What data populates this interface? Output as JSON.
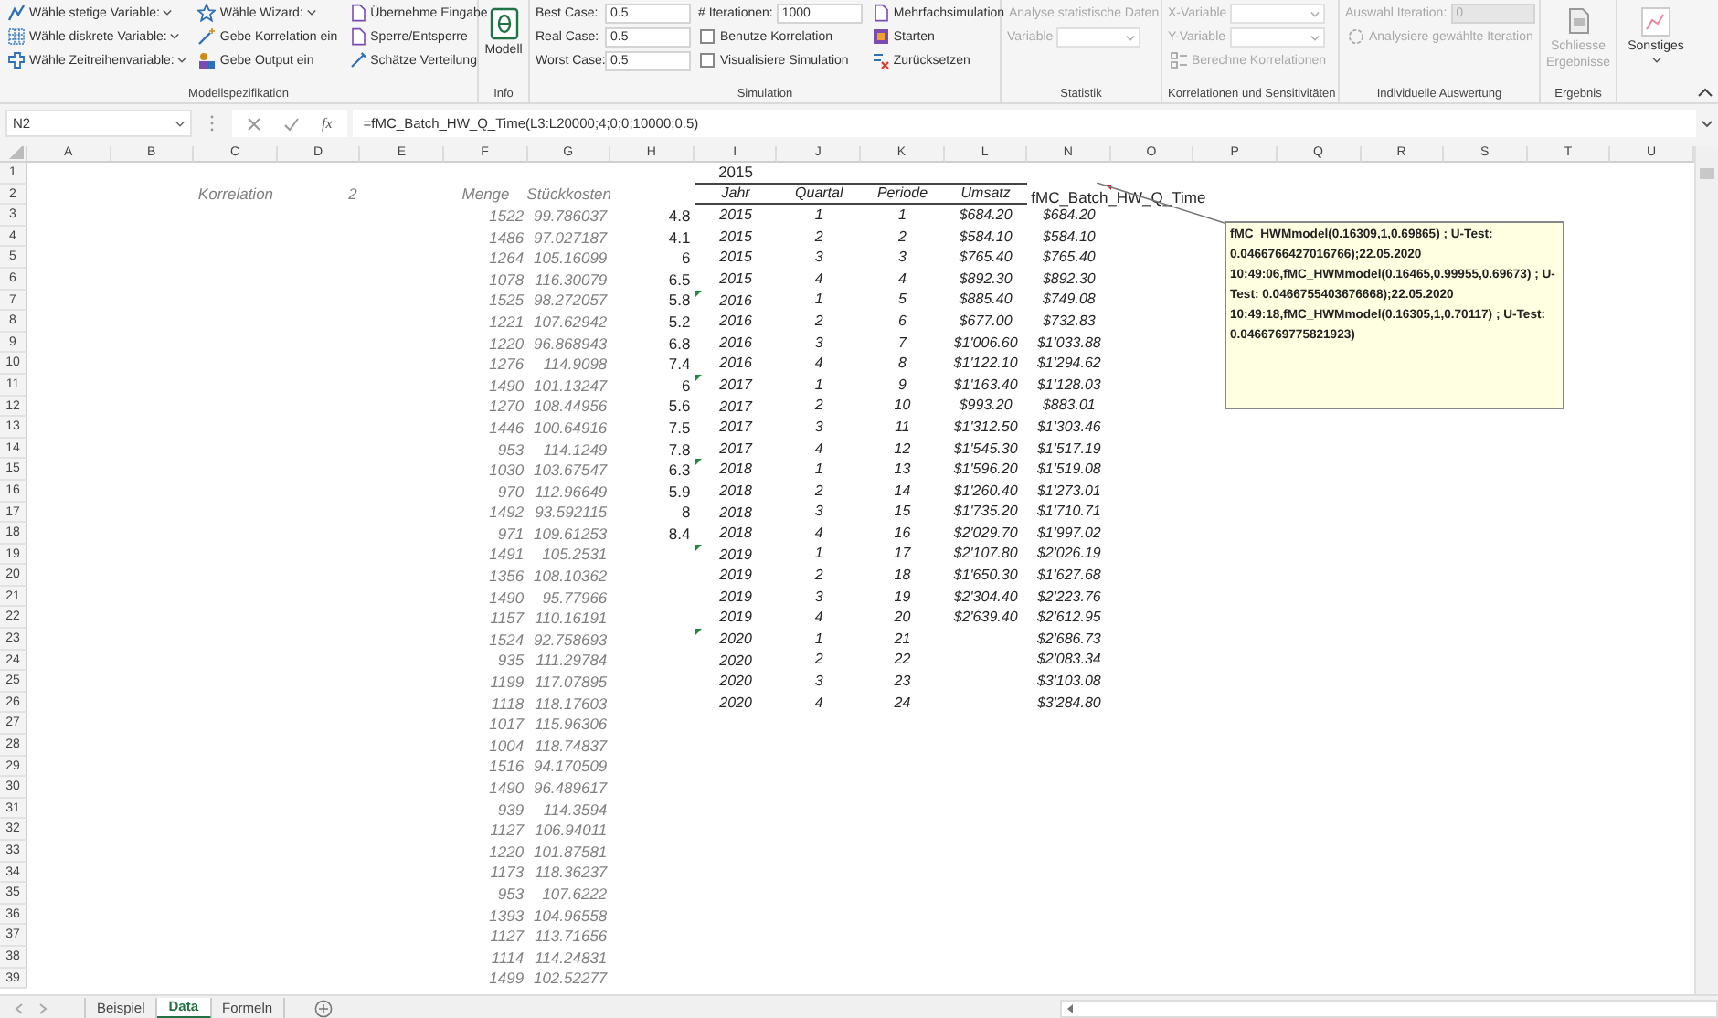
{
  "ribbon": {
    "modellspezifikation": {
      "label": "Modellspezifikation",
      "columns": [
        [
          {
            "label": "Wähle stetige Variable:",
            "dropdown": true
          },
          {
            "label": "Wähle diskrete Variable:",
            "dropdown": true
          },
          {
            "label": "Wähle Zeitreihenvariable:",
            "dropdown": true
          }
        ],
        [
          {
            "label": "Wähle Wizard:",
            "dropdown": true
          },
          {
            "label": "Gebe Korrelation ein",
            "dropdown": false
          },
          {
            "label": "Gebe Output ein",
            "dropdown": false
          }
        ],
        [
          {
            "label": "Übernehme Eingabe",
            "dropdown": false
          },
          {
            "label": "Sperre/Entsperre",
            "dropdown": false
          },
          {
            "label": "Schätze Verteilung",
            "dropdown": false
          }
        ]
      ]
    },
    "info": {
      "label": "Info",
      "button": "Modell"
    },
    "simulation": {
      "label": "Simulation",
      "fields": [
        {
          "label": "Best Case:",
          "value": "0.5"
        },
        {
          "label": "Real Case:",
          "value": "0.5"
        },
        {
          "label": "Worst Case:",
          "value": "0.5"
        }
      ],
      "iterations": {
        "label": "# Iterationen:",
        "value": "1000"
      },
      "checkboxes": [
        {
          "label": "Benutze Korrelation",
          "checked": false
        },
        {
          "label": "Visualisiere Simulation",
          "checked": false
        }
      ],
      "buttons": [
        "Mehrfachsimulation",
        "Starten",
        "Zurücksetzen"
      ]
    },
    "statistik": {
      "label": "Statistik",
      "button": {
        "label": "Analyse statistische Daten",
        "disabled": true
      },
      "dropdown": {
        "label": "Variable",
        "disabled": true
      }
    },
    "korrelationen": {
      "label": "Korrelationen und Sensitivitäten",
      "dropdowns": [
        {
          "label": "X-Variable",
          "disabled": true
        },
        {
          "label": "Y-Variable",
          "disabled": true
        }
      ],
      "button": {
        "label": "Berechne Korrelationen",
        "disabled": true
      }
    },
    "auswertung": {
      "label": "Individuelle Auswertung",
      "field": {
        "label": "Auswahl Iteration:",
        "value": "0",
        "disabled": true
      },
      "button": {
        "label": "Analysiere gewählte Iteration",
        "disabled": true
      }
    },
    "ergebnis": {
      "label": "Ergebnis",
      "button": {
        "label": "Schliesse Ergebnisse",
        "disabled": true
      }
    },
    "sonstiges": {
      "button": "Sonstiges"
    }
  },
  "formula_bar": {
    "name_box": "N2",
    "function_label": "fx",
    "formula": "=fMC_Batch_HW_Q_Time(L3:L20000;4;0;0;10000;0.5)"
  },
  "sheet": {
    "columns": [
      "A",
      "B",
      "C",
      "D",
      "E",
      "F",
      "G",
      "H",
      "I",
      "J",
      "K",
      "L",
      "N",
      "O",
      "P",
      "Q",
      "R",
      "S",
      "T",
      "U"
    ],
    "row_numbers": [
      "1",
      "2",
      "3",
      "4",
      "5",
      "6",
      "7",
      "8",
      "9",
      "10",
      "11",
      "12",
      "13",
      "14",
      "15",
      "16",
      "17",
      "18",
      "19",
      "20",
      "21",
      "22",
      "23",
      "24",
      "25",
      "26",
      "27",
      "28",
      "29",
      "30",
      "31",
      "32",
      "33",
      "34",
      "35",
      "36",
      "37",
      "38",
      "39"
    ],
    "korrelation": {
      "label": "Korrelation",
      "value": "2"
    },
    "data_table": {
      "headers": [
        "Menge",
        "Stückkosten"
      ],
      "rows": [
        {
          "menge": "1522",
          "stueckkosten": "99.786037"
        },
        {
          "menge": "1486",
          "stueckkosten": "97.027187"
        },
        {
          "menge": "1264",
          "stueckkosten": "105.16099"
        },
        {
          "menge": "1078",
          "stueckkosten": "116.30079"
        },
        {
          "menge": "1525",
          "stueckkosten": "98.272057"
        },
        {
          "menge": "1221",
          "stueckkosten": "107.62942"
        },
        {
          "menge": "1220",
          "stueckkosten": "96.868943"
        },
        {
          "menge": "1276",
          "stueckkosten": "114.9098"
        },
        {
          "menge": "1490",
          "stueckkosten": "101.13247"
        },
        {
          "menge": "1270",
          "stueckkosten": "108.44956"
        },
        {
          "menge": "1446",
          "stueckkosten": "100.64916"
        },
        {
          "menge": "953",
          "stueckkosten": "114.1249"
        },
        {
          "menge": "1030",
          "stueckkosten": "103.67547"
        },
        {
          "menge": "970",
          "stueckkosten": "112.96649"
        },
        {
          "menge": "1492",
          "stueckkosten": "93.592115"
        },
        {
          "menge": "971",
          "stueckkosten": "109.61253"
        },
        {
          "menge": "1491",
          "stueckkosten": "105.2531"
        },
        {
          "menge": "1356",
          "stueckkosten": "108.10362"
        },
        {
          "menge": "1490",
          "stueckkosten": "95.77966"
        },
        {
          "menge": "1157",
          "stueckkosten": "110.16191"
        },
        {
          "menge": "1524",
          "stueckkosten": "92.758693"
        },
        {
          "menge": "935",
          "stueckkosten": "111.29784"
        },
        {
          "menge": "1199",
          "stueckkosten": "117.07895"
        },
        {
          "menge": "1118",
          "stueckkosten": "118.17603"
        },
        {
          "menge": "1017",
          "stueckkosten": "115.96306"
        },
        {
          "menge": "1004",
          "stueckkosten": "118.74837"
        },
        {
          "menge": "1516",
          "stueckkosten": "94.170509"
        },
        {
          "menge": "1490",
          "stueckkosten": "96.489617"
        },
        {
          "menge": "939",
          "stueckkosten": "114.3594"
        },
        {
          "menge": "1127",
          "stueckkosten": "106.94011"
        },
        {
          "menge": "1220",
          "stueckkosten": "101.87581"
        },
        {
          "menge": "1173",
          "stueckkosten": "118.36237"
        },
        {
          "menge": "953",
          "stueckkosten": "107.6222"
        },
        {
          "menge": "1393",
          "stueckkosten": "104.96558"
        },
        {
          "menge": "1127",
          "stueckkosten": "113.71656"
        },
        {
          "menge": "1114",
          "stueckkosten": "114.24831"
        },
        {
          "menge": "1499",
          "stueckkosten": "102.52277"
        }
      ]
    },
    "main_table": {
      "title": "2015",
      "headers": [
        "Jahr",
        "Quartal",
        "Periode",
        "Umsatz",
        "fMC_Batch_HW_Q_Time"
      ],
      "rows": [
        {
          "column_h": "4.8",
          "jahr": "2015",
          "quartal": "1",
          "periode": "1",
          "umsatz": "$684.20",
          "forecast": "$684.20",
          "warning": false
        },
        {
          "column_h": "4.1",
          "jahr": "2015",
          "quartal": "2",
          "periode": "2",
          "umsatz": "$584.10",
          "forecast": "$584.10",
          "warning": false
        },
        {
          "column_h": "6",
          "jahr": "2015",
          "quartal": "3",
          "periode": "3",
          "umsatz": "$765.40",
          "forecast": "$765.40",
          "warning": false
        },
        {
          "column_h": "6.5",
          "jahr": "2015",
          "quartal": "4",
          "periode": "4",
          "umsatz": "$892.30",
          "forecast": "$892.30",
          "warning": false
        },
        {
          "column_h": "5.8",
          "jahr": "2016",
          "quartal": "1",
          "periode": "5",
          "umsatz": "$885.40",
          "forecast": "$749.08",
          "warning": true
        },
        {
          "column_h": "5.2",
          "jahr": "2016",
          "quartal": "2",
          "periode": "6",
          "umsatz": "$677.00",
          "forecast": "$732.83",
          "warning": false
        },
        {
          "column_h": "6.8",
          "jahr": "2016",
          "quartal": "3",
          "periode": "7",
          "umsatz": "$1'006.60",
          "forecast": "$1'033.88",
          "warning": false
        },
        {
          "column_h": "7.4",
          "jahr": "2016",
          "quartal": "4",
          "periode": "8",
          "umsatz": "$1'122.10",
          "forecast": "$1'294.62",
          "warning": false
        },
        {
          "column_h": "6",
          "jahr": "2017",
          "quartal": "1",
          "periode": "9",
          "umsatz": "$1'163.40",
          "forecast": "$1'128.03",
          "warning": true
        },
        {
          "column_h": "5.6",
          "jahr": "2017",
          "quartal": "2",
          "periode": "10",
          "umsatz": "$993.20",
          "forecast": "$883.01",
          "warning": false
        },
        {
          "column_h": "7.5",
          "jahr": "2017",
          "quartal": "3",
          "periode": "11",
          "umsatz": "$1'312.50",
          "forecast": "$1'303.46",
          "warning": false
        },
        {
          "column_h": "7.8",
          "jahr": "2017",
          "quartal": "4",
          "periode": "12",
          "umsatz": "$1'545.30",
          "forecast": "$1'517.19",
          "warning": false
        },
        {
          "column_h": "6.3",
          "jahr": "2018",
          "quartal": "1",
          "periode": "13",
          "umsatz": "$1'596.20",
          "forecast": "$1'519.08",
          "warning": true
        },
        {
          "column_h": "5.9",
          "jahr": "2018",
          "quartal": "2",
          "periode": "14",
          "umsatz": "$1'260.40",
          "forecast": "$1'273.01",
          "warning": false
        },
        {
          "column_h": "8",
          "jahr": "2018",
          "quartal": "3",
          "periode": "15",
          "umsatz": "$1'735.20",
          "forecast": "$1'710.71",
          "warning": false
        },
        {
          "column_h": "8.4",
          "jahr": "2018",
          "quartal": "4",
          "periode": "16",
          "umsatz": "$2'029.70",
          "forecast": "$1'997.02",
          "warning": false
        },
        {
          "jahr": "2019",
          "quartal": "1",
          "periode": "17",
          "umsatz": "$2'107.80",
          "forecast": "$2'026.19",
          "warning": true
        },
        {
          "jahr": "2019",
          "quartal": "2",
          "periode": "18",
          "umsatz": "$1'650.30",
          "forecast": "$1'627.68",
          "warning": false
        },
        {
          "jahr": "2019",
          "quartal": "3",
          "periode": "19",
          "umsatz": "$2'304.40",
          "forecast": "$2'223.76",
          "warning": false
        },
        {
          "jahr": "2019",
          "quartal": "4",
          "periode": "20",
          "umsatz": "$2'639.40",
          "forecast": "$2'612.95",
          "warning": false
        },
        {
          "jahr": "2020",
          "quartal": "1",
          "periode": "21",
          "forecast": "$2'686.73",
          "warning": true
        },
        {
          "jahr": "2020",
          "quartal": "2",
          "periode": "22",
          "forecast": "$2'083.34",
          "warning": false
        },
        {
          "jahr": "2020",
          "quartal": "3",
          "periode": "23",
          "forecast": "$3'103.08",
          "warning": false
        },
        {
          "jahr": "2020",
          "quartal": "4",
          "periode": "24",
          "forecast": "$3'284.80",
          "warning": false
        }
      ]
    },
    "comment": "fMC_HWMmodel(0.16309,1,0.69865) ; U-Test: 0.0466766427016766);22.05.2020 10:49:06,fMC_HWMmodel(0.16465,0.99955,0.69673) ; U-Test: 0.0466755403676668);22.05.2020 10:49:18,fMC_HWMmodel(0.16305,1,0.70117) ; U-Test: 0.0466769775821923)"
  },
  "sheet_tabs": [
    {
      "label": "Beispiel",
      "selected": false
    },
    {
      "label": "Data",
      "selected": true
    },
    {
      "label": "Formeln",
      "selected": false
    }
  ]
}
